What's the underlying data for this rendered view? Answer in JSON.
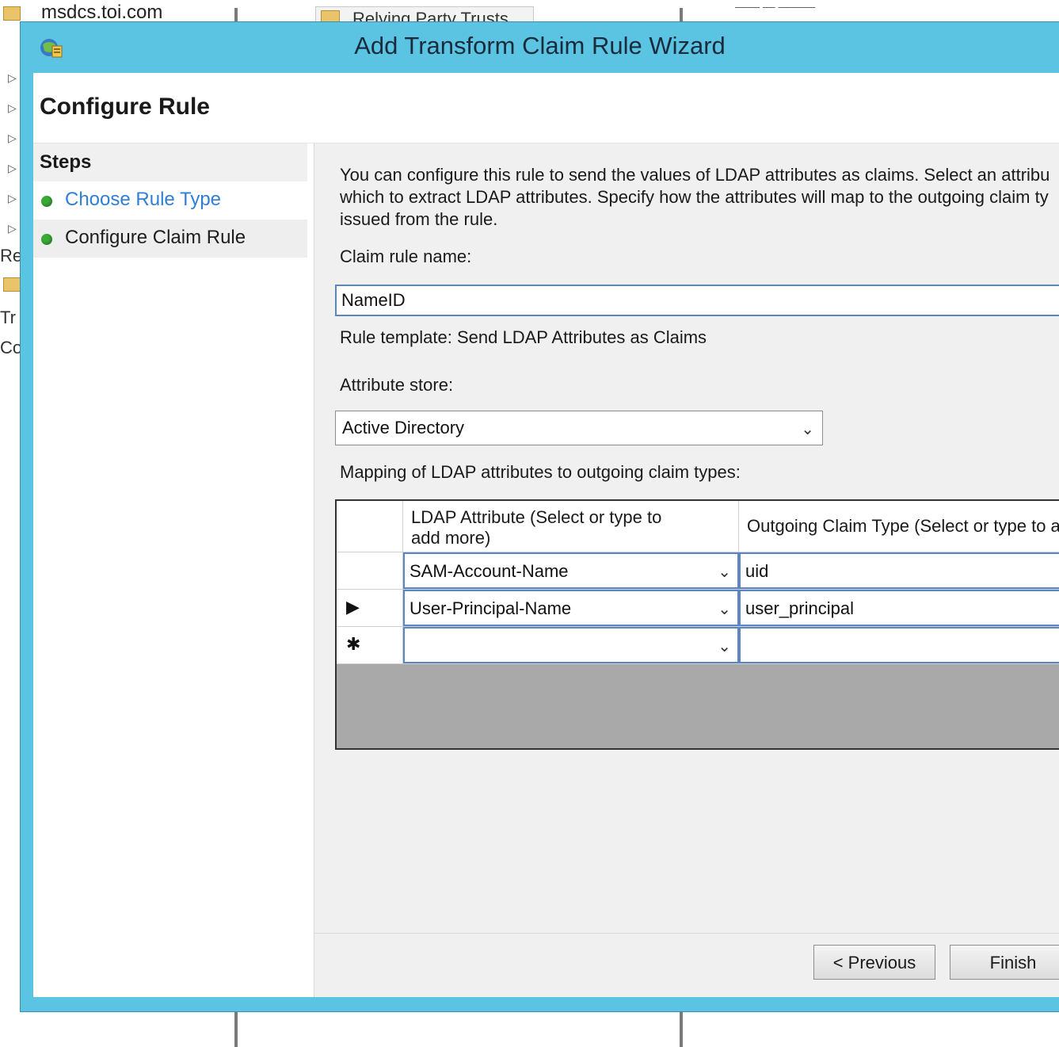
{
  "background": {
    "domain_text": "msdcs.toi.com",
    "tab_label": "Relying Party Trusts",
    "side_fragments": [
      "Re",
      "Tr",
      "Co"
    ]
  },
  "dialog": {
    "title": "Add Transform Claim Rule Wizard",
    "page_title": "Configure Rule",
    "steps": {
      "header": "Steps",
      "items": [
        {
          "label": "Choose Rule Type",
          "state": "link"
        },
        {
          "label": "Configure Claim Rule",
          "state": "current"
        }
      ]
    },
    "description": "You can configure this rule to send the values of LDAP attributes as claims. Select an attribu\nwhich to extract LDAP attributes. Specify how the attributes will map to the outgoing claim ty\nissued from the rule.",
    "claim_rule_name_label": "Claim rule name:",
    "claim_rule_name_value": "NameID",
    "rule_template_text": "Rule template: Send LDAP Attributes as Claims",
    "attribute_store_label": "Attribute store:",
    "attribute_store_value": "Active Directory",
    "mapping_label": "Mapping of LDAP attributes to outgoing claim types:",
    "grid": {
      "col_ldap": "LDAP Attribute (Select or type to\nadd more)",
      "col_claim": "Outgoing Claim Type (Select or type to a",
      "rows": [
        {
          "marker": "",
          "ldap": "SAM-Account-Name",
          "claim": "uid"
        },
        {
          "marker": "▶",
          "ldap": "User-Principal-Name",
          "claim": "user_principal"
        },
        {
          "marker": "✱",
          "ldap": "",
          "claim": ""
        }
      ]
    },
    "buttons": {
      "previous": "< Previous",
      "finish": "Finish"
    }
  },
  "colors": {
    "titlebar": "#5bc4e3",
    "step_link": "#2f7fd8",
    "step_dot": "#3aaa35",
    "grid_empty": "#a9a9a9"
  }
}
